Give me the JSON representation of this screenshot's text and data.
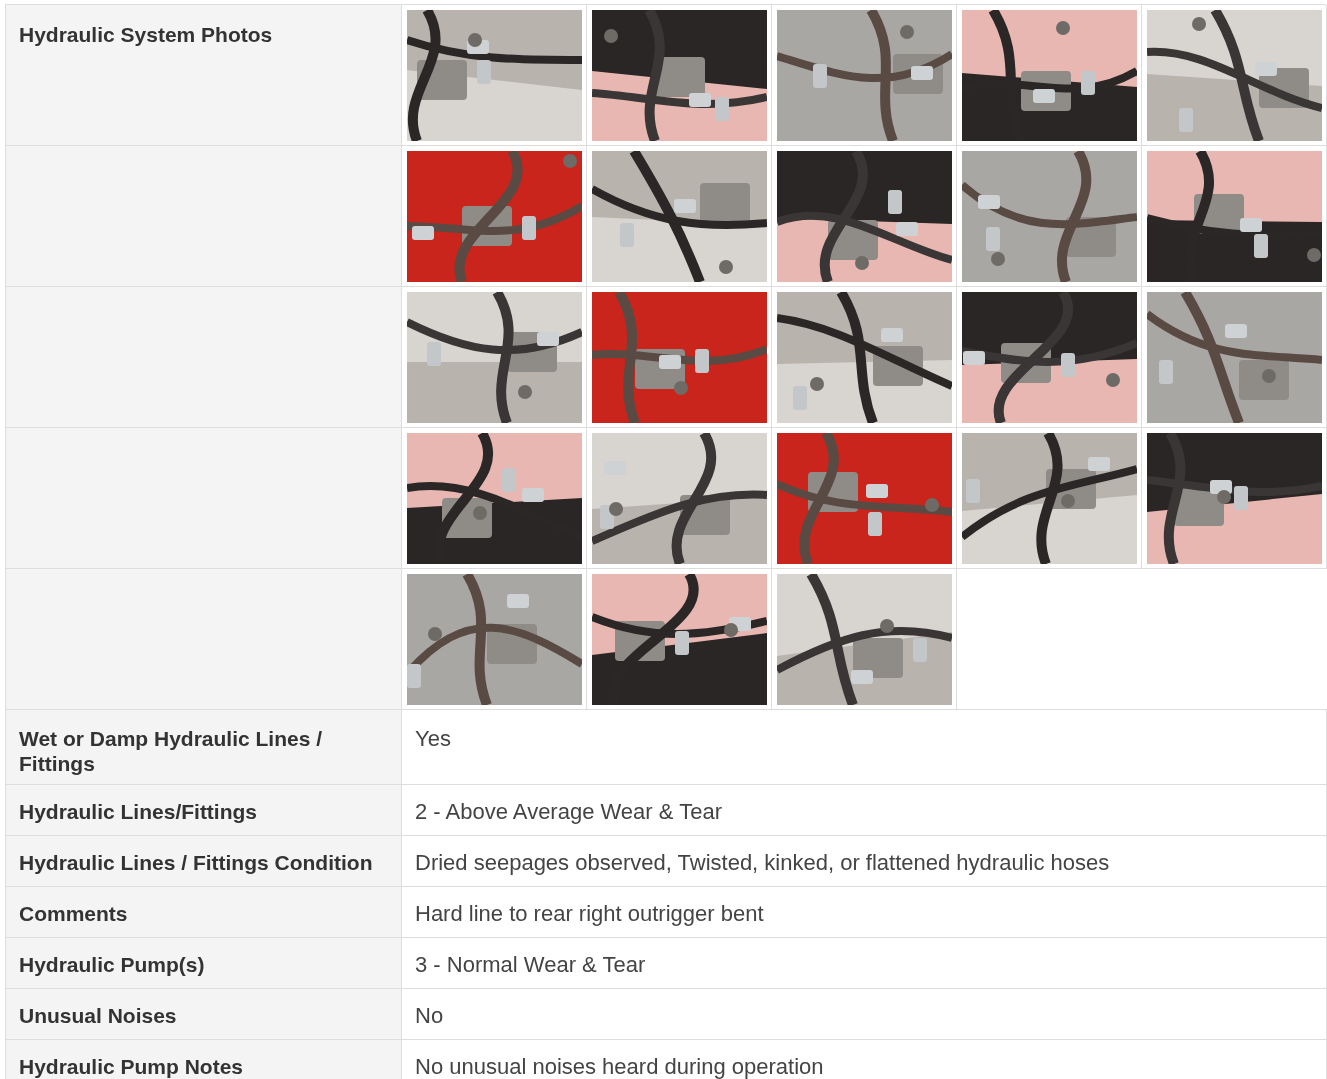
{
  "photo_section": {
    "label": "Hydraulic System Photos"
  },
  "fields": [
    {
      "label": "Wet or Damp Hydraulic Lines / Fittings",
      "value": "Yes"
    },
    {
      "label": "Hydraulic Lines/Fittings",
      "value": "2 - Above Average Wear & Tear"
    },
    {
      "label": "Hydraulic Lines / Fittings Condition",
      "value": "Dried seepages observed, Twisted, kinked, or flattened hydraulic hoses"
    },
    {
      "label": "Comments",
      "value": "Hard line to rear right outrigger bent"
    },
    {
      "label": "Hydraulic Pump(s)",
      "value": "3 - Normal Wear & Tear"
    },
    {
      "label": "Unusual Noises",
      "value": "No"
    },
    {
      "label": "Hydraulic Pump Notes",
      "value": "No unusual noises heard during operation"
    }
  ]
}
